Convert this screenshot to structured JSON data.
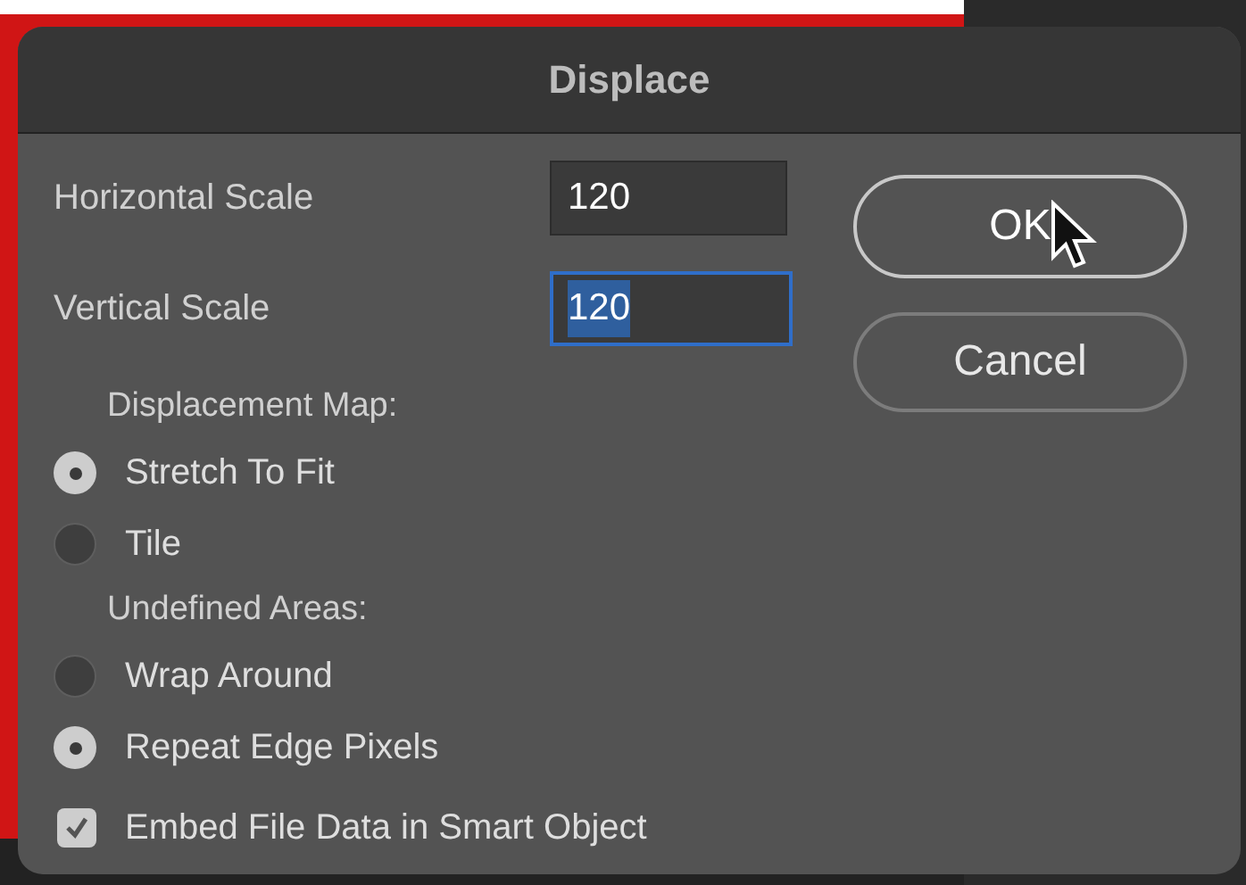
{
  "window": {
    "title": "Displace"
  },
  "fields": [
    {
      "label": "Horizontal Scale",
      "value": "120",
      "focused": false
    },
    {
      "label": "Vertical Scale",
      "value": "120",
      "focused": true
    }
  ],
  "buttons": [
    {
      "label": "OK",
      "hovered": true
    },
    {
      "label": "Cancel",
      "hovered": false
    }
  ],
  "groups": [
    {
      "title": "Displacement Map:",
      "options": [
        {
          "label": "Stretch To Fit",
          "selected": true
        },
        {
          "label": "Tile",
          "selected": false
        }
      ]
    },
    {
      "title": "Undefined Areas:",
      "options": [
        {
          "label": "Wrap Around",
          "selected": false
        },
        {
          "label": "Repeat Edge Pixels",
          "selected": true
        }
      ]
    }
  ],
  "checkbox": {
    "label": "Embed File Data in Smart Object",
    "checked": true
  }
}
